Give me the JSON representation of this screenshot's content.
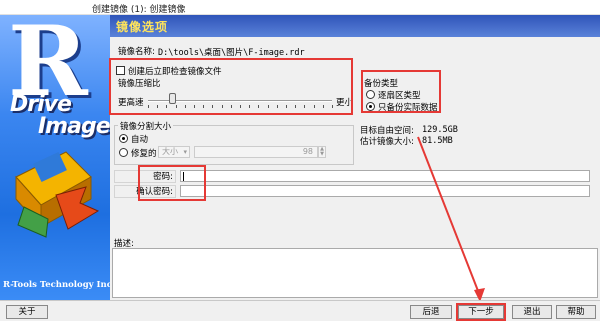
{
  "window": {
    "title": "创建镜像 (1): 创建镜像"
  },
  "banner": {
    "logo_letter": "R",
    "logo_word1": "Drive",
    "logo_word2": "Image",
    "company": "R-Tools Technology Inc."
  },
  "header": {
    "title": "镜像选项"
  },
  "image_name": {
    "label": "镜像名称:",
    "value": "D:\\tools\\桌面\\图片\\F-image.rdr"
  },
  "verify": {
    "label": "创建后立即检查镜像文件",
    "checked": false
  },
  "compression": {
    "label": "镜像压缩比",
    "left_label": "更高速",
    "right_label": "更小",
    "level": 0.13
  },
  "backup_type": {
    "label": "备份类型",
    "options": [
      "逐扇区类型",
      "只备份实际数据"
    ],
    "selected": 1
  },
  "space": {
    "free_label": "目标自由空间:",
    "free_value": "129.5GB",
    "size_label": "估计镜像大小:",
    "size_value": "81.5MB"
  },
  "split": {
    "label": "镜像分割大小",
    "auto_label": "自动",
    "fixed_label": "修复的",
    "fixed_unit": "大小",
    "fixed_number": "98",
    "selected": "auto"
  },
  "password": {
    "label": "密码:",
    "confirm_label": "确认密码:",
    "value": "",
    "confirm_value": ""
  },
  "description": {
    "label": "描述:"
  },
  "buttons": {
    "about": "关于",
    "back": "后退",
    "next": "下一步",
    "exit": "退出",
    "help": "帮助"
  },
  "colors": {
    "annotation_red": "#e53935",
    "header_blue": "#2f55b9",
    "header_text": "#ffe45c"
  }
}
